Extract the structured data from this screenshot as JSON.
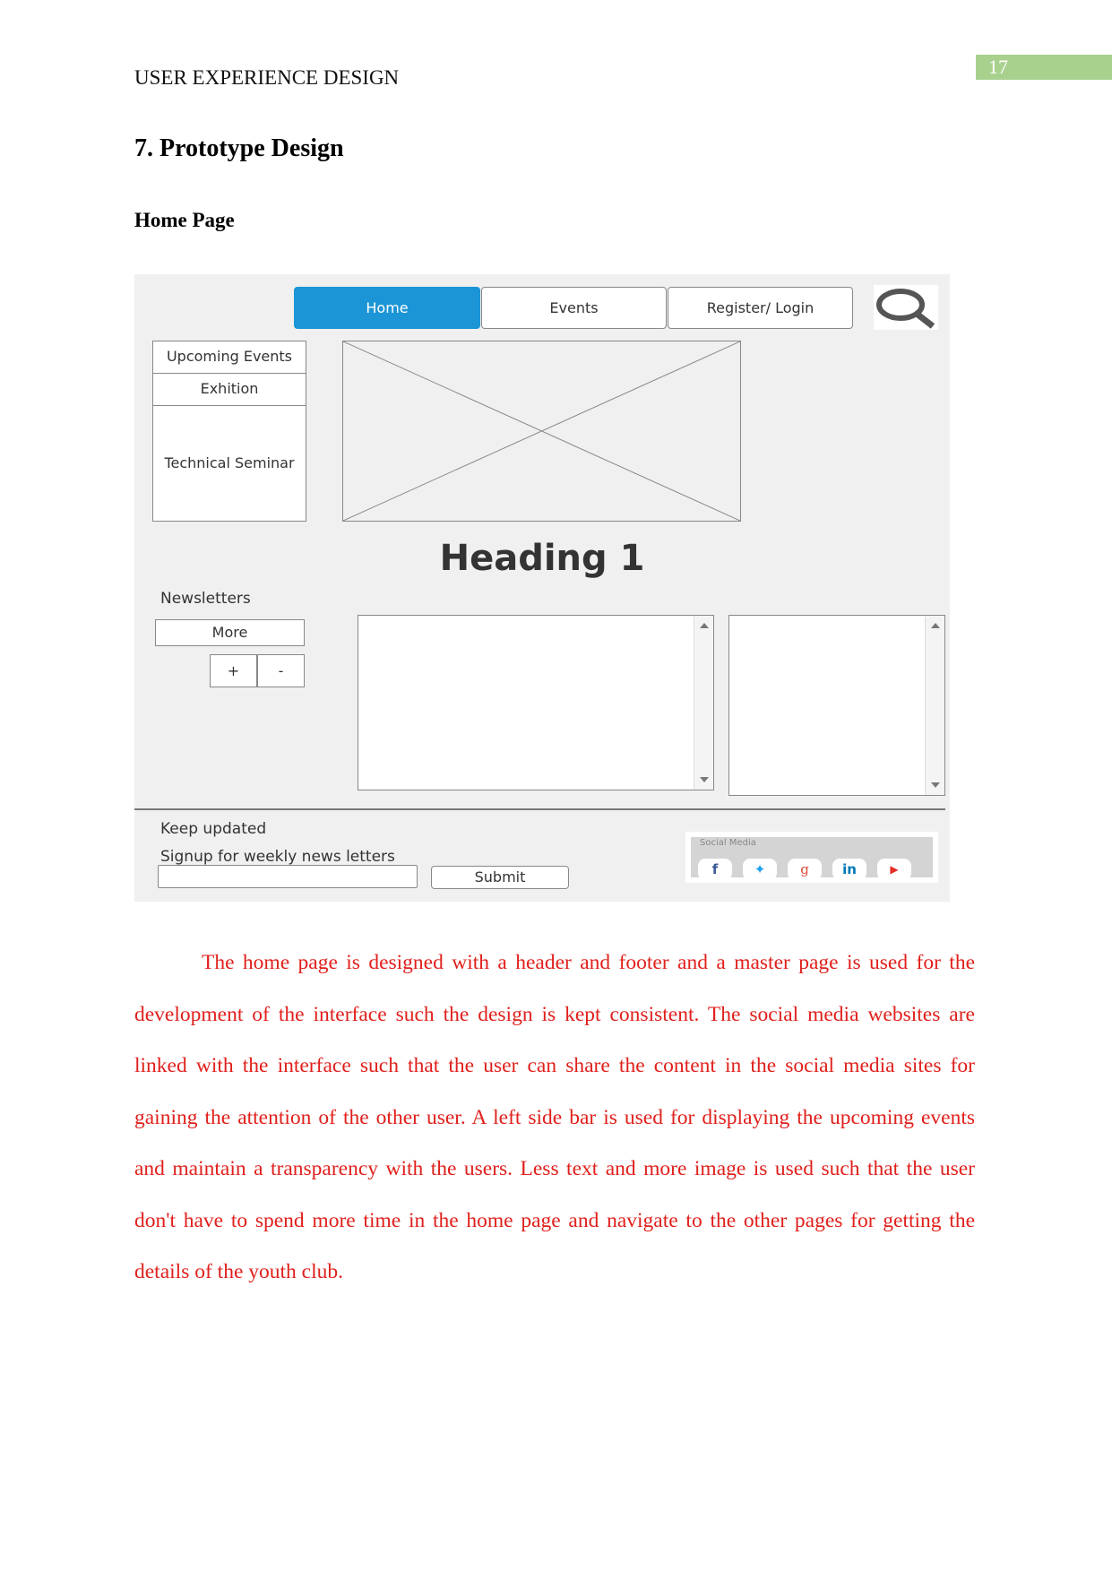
{
  "header": {
    "running_title": "USER EXPERIENCE DESIGN",
    "page_number": "17",
    "page_number_bg": "#a9d18e"
  },
  "section_title": "7. Prototype Design",
  "subsection_title": "Home Page",
  "wireframe": {
    "nav": {
      "home": "Home",
      "events": "Events",
      "register": "Register/ Login",
      "search_icon": "search-icon",
      "active_color": "#1b95d6"
    },
    "sidebar": [
      "Upcoming Events",
      "Exhition",
      "Technical Seminar"
    ],
    "heading": "Heading 1",
    "newsletters_label": "Newsletters",
    "more_button": "More",
    "plus": "+",
    "minus": "-",
    "footer": {
      "keep_updated": "Keep updated",
      "signup": "Signup for weekly news letters",
      "input_value": "",
      "submit": "Submit",
      "social_label": "Social Media",
      "social_icons": [
        {
          "name": "facebook-icon",
          "glyph": "f",
          "color": "#3b5998"
        },
        {
          "name": "twitter-icon",
          "glyph": "🐦",
          "color": "#1da1f2"
        },
        {
          "name": "google-plus-icon",
          "glyph": "g",
          "color": "#dd4b39"
        },
        {
          "name": "linkedin-icon",
          "glyph": "in",
          "color": "#0077b5"
        },
        {
          "name": "youtube-icon",
          "glyph": "▶",
          "color": "#e52d27"
        }
      ]
    }
  },
  "paragraph": "The home page is designed with a header and footer and a master page is used for the development of the interface such the design is kept consistent. The social media websites are linked with the interface such that the user can share the content in the social media sites for gaining the attention of the other user. A left side bar is used for displaying the upcoming events and maintain a transparency with the users. Less text and more image is used such that the user don't have to spend more time in the home page and navigate to the other pages for getting the details of the youth club."
}
